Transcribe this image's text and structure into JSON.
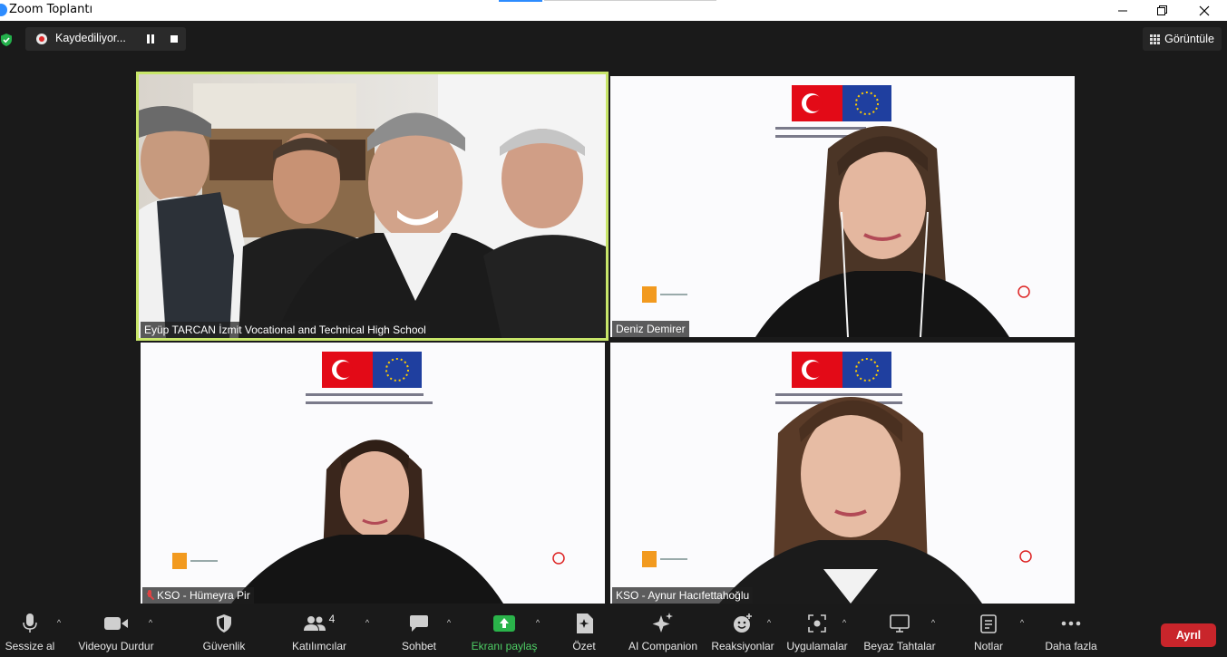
{
  "window": {
    "title": "Zoom Toplantı",
    "controls": {
      "minimize": "—",
      "maximize": "❐",
      "close": "✕"
    }
  },
  "meeting": {
    "recording_label": "Kaydediliyor...",
    "view_label": "Görüntüle"
  },
  "participants": [
    {
      "name": "Eyüp TARCAN İzmit Vocational and Technical High School",
      "muted": false,
      "active_speaker": true
    },
    {
      "name": "Deniz Demirer",
      "muted": false,
      "active_speaker": false
    },
    {
      "name": "KSO - Hümeyra Pir",
      "muted": true,
      "active_speaker": false
    },
    {
      "name": "KSO - Aynur Hacıfettahoğlu",
      "muted": false,
      "active_speaker": false
    }
  ],
  "toolbar": {
    "mute": "Sessize al",
    "video": "Videoyu Durdur",
    "security": "Güvenlik",
    "participants": "Katılımcılar",
    "participants_count": "4",
    "chat": "Sohbet",
    "share": "Ekranı paylaş",
    "summary": "Özet",
    "ai": "AI Companion",
    "reactions": "Reaksiyonlar",
    "apps": "Uygulamalar",
    "whiteboard": "Beyaz Tahtalar",
    "notes": "Notlar",
    "more": "Daha fazla",
    "leave": "Ayrıl"
  },
  "colors": {
    "active_border": "#c8e66a",
    "share_green": "#4ecf65",
    "leave_red": "#c9252b",
    "background": "#1a1a1a"
  }
}
